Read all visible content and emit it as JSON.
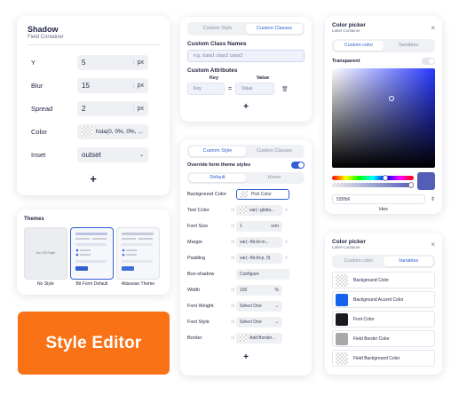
{
  "shadow": {
    "title": "Shadow",
    "subtitle": "Field Container",
    "rows": [
      {
        "label": "Y",
        "value": "5",
        "unit": "px"
      },
      {
        "label": "Blur",
        "value": "15",
        "unit": "px"
      },
      {
        "label": "Spread",
        "value": "2",
        "unit": "px"
      },
      {
        "label": "Color",
        "value": "hsla(0, 0%, 0%, ..."
      },
      {
        "label": "Inset",
        "value": "outset"
      }
    ]
  },
  "themes": {
    "title": "Themes",
    "items": [
      {
        "name": "No Style",
        "thumb_text": "No CSS Style"
      },
      {
        "name": "Bit Form Default"
      },
      {
        "name": "Atlassian Theme"
      }
    ]
  },
  "banner": {
    "text": "Style Editor"
  },
  "classes": {
    "tabs": [
      "Custom Style",
      "Custom Classes"
    ],
    "custom_class_names": "Custom Class Names",
    "class_placeholder": "e.g. class1 class2 class3",
    "custom_attributes": "Custom Attributes",
    "key_header": "Key",
    "value_header": "Value",
    "key_placeholder": "Key",
    "equals": "=",
    "value_placeholder": "Value"
  },
  "picker1": {
    "title": "Color picker",
    "subtitle": "Label Container",
    "tabs": [
      "Custom color",
      "Variables"
    ],
    "transparent_label": "Transparent",
    "hex_value": "535fb6",
    "hex_label": "Hex",
    "colors": {
      "current": "#535fb6",
      "accent": "#2f5fd0"
    }
  },
  "override": {
    "tabs": [
      "Custom Style",
      "Custom Classes"
    ],
    "override_label": "Override form theme styles",
    "state_tabs": [
      "Default",
      "Hover"
    ],
    "rows": [
      {
        "label": "Background Color",
        "value": "Pick Color"
      },
      {
        "label": "Text Color",
        "value": "var(--globa..."
      },
      {
        "label": "Font Size",
        "value": "1",
        "unit": "rem"
      },
      {
        "label": "Margin",
        "value": "var(--fld-bl-m..."
      },
      {
        "label": "Padding",
        "value": "var(--fld-bl-p, 0)"
      },
      {
        "label": "Box-shadow",
        "value": "Configure"
      },
      {
        "label": "Width",
        "value": "100",
        "unit": "%"
      },
      {
        "label": "Font Weight",
        "value": "Select One"
      },
      {
        "label": "Font Style",
        "value": "Select One"
      },
      {
        "label": "Border",
        "value": "Add Border..."
      }
    ]
  },
  "picker2": {
    "title": "Color picker",
    "subtitle": "Label Container",
    "tabs": [
      "Custom color",
      "Variables"
    ],
    "variables": [
      {
        "label": "Background Color",
        "color": "checker"
      },
      {
        "label": "Background Accent Color",
        "color": "#1464f0"
      },
      {
        "label": "Font Color",
        "color": "#1b1b1f"
      },
      {
        "label": "Field Border Color",
        "color": "#a9a9a9"
      },
      {
        "label": "Field Background Color",
        "color": "checker"
      }
    ]
  }
}
